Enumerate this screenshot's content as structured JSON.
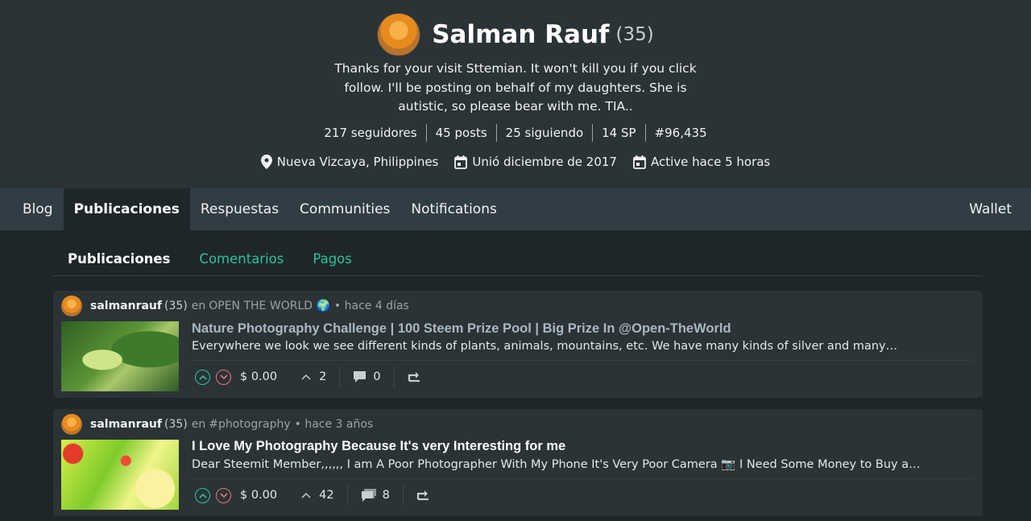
{
  "profile": {
    "name": "Salman Rauf",
    "reputation": "(35)",
    "about": "Thanks for your visit Sttemian. It won't kill you if you click follow. I'll be posting on behalf of my daughters. She is autistic, so please bear with me. TIA..",
    "stats": {
      "followers": "217 seguidores",
      "posts": "45 posts",
      "following": "25 siguiendo",
      "sp": "14 SP",
      "rank": "#96,435"
    },
    "location": "Nueva Vizcaya, Philippines",
    "joined": "Unió diciembre de 2017",
    "active": "Active hace 5 horas"
  },
  "nav": {
    "tabs": [
      "Blog",
      "Publicaciones",
      "Respuestas",
      "Communities",
      "Notifications"
    ],
    "active": "Publicaciones",
    "wallet": "Wallet"
  },
  "subtabs": {
    "items": [
      "Publicaciones",
      "Comentarios",
      "Pagos"
    ],
    "active": "Publicaciones"
  },
  "posts": [
    {
      "author": "salmanrauf",
      "author_rep": "(35)",
      "community_prefix": "en",
      "community": "OPEN THE WORLD 🌍",
      "time": "• hace 4 días",
      "title": "Nature Photography Challenge | 100 Steem Prize Pool | Big Prize In @Open-TheWorld",
      "excerpt": "Everywhere we look we see different kinds of plants, animals, mountains, etc. We have many kinds of silver and many…",
      "payout": "$ 0.00",
      "votes": "2",
      "comments": "0"
    },
    {
      "author": "salmanrauf",
      "author_rep": "(35)",
      "community_prefix": "en",
      "community": "#photography",
      "time": "• hace 3 años",
      "title": "I Love My Photography Because It's very Interesting for me",
      "excerpt": "Dear Steemit Member,,,,,, I am A Poor Photographer With My Phone It's Very Poor Camera 📷 I Need Some Money to Buy a…",
      "payout": "$ 0.00",
      "votes": "42",
      "comments": "8"
    }
  ],
  "colors": {
    "accent": "#2ac4a0",
    "downvote": "#e8737a",
    "header_bg": "#2b3336",
    "nav_bg": "#313d44",
    "page_bg": "#1f2629"
  }
}
